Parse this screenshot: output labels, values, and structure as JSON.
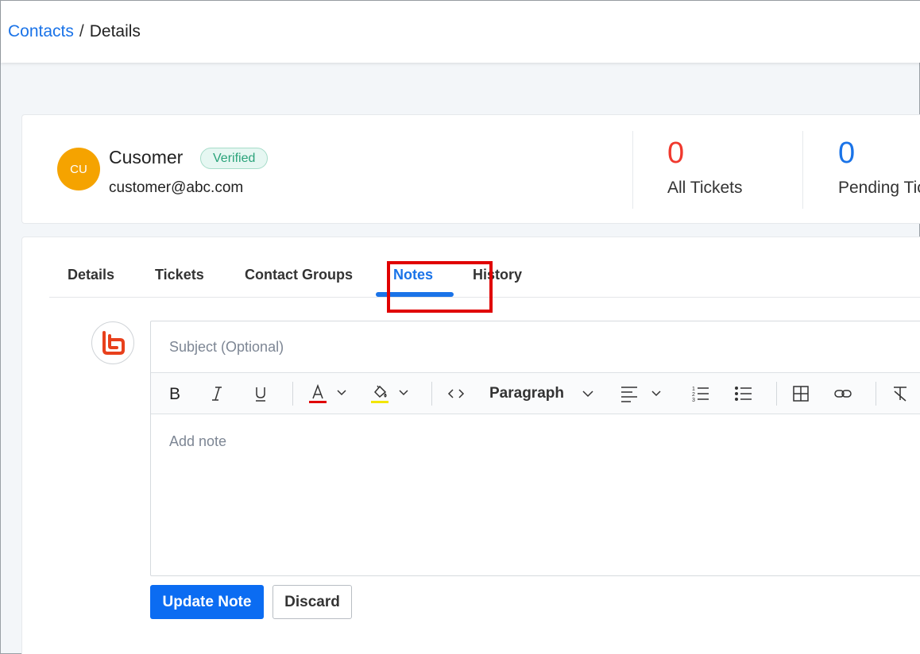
{
  "breadcrumb": {
    "link": "Contacts",
    "separator": "/",
    "current": "Details"
  },
  "contact": {
    "initials": "CU",
    "name": "Cusomer",
    "status": "Verified",
    "email": "customer@abc.com",
    "avatar_color": "#f5a300"
  },
  "stats": [
    {
      "value": "0",
      "label": "All Tickets",
      "color": "#f0392e"
    },
    {
      "value": "0",
      "label": "Pending Tic",
      "color": "#1a73e8"
    }
  ],
  "tabs": [
    {
      "label": "Details",
      "active": false
    },
    {
      "label": "Tickets",
      "active": false
    },
    {
      "label": "Contact Groups",
      "active": false
    },
    {
      "label": "Notes",
      "active": true
    },
    {
      "label": "History",
      "active": false
    }
  ],
  "editor": {
    "subject_placeholder": "Subject (Optional)",
    "body_placeholder": "Add note",
    "block_format": "Paragraph",
    "toolbar_icons": [
      "bold-icon",
      "italic-icon",
      "underline-icon",
      "font-color-icon",
      "highlight-color-icon",
      "code-icon",
      "align-left-icon",
      "numbered-list-icon",
      "bulleted-list-icon",
      "table-icon",
      "link-icon",
      "clear-format-icon"
    ]
  },
  "actions": {
    "primary": "Update Note",
    "secondary": "Discard"
  },
  "colors": {
    "accent": "#1a73e8",
    "primary_button": "#0b6cf2",
    "highlight": "#e00000"
  }
}
